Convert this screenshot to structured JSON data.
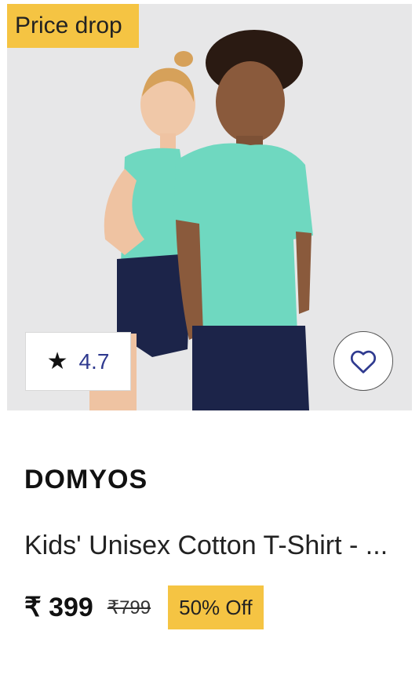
{
  "badge": {
    "label": "Price drop",
    "color": "#f5c443"
  },
  "rating": {
    "icon": "star-icon",
    "value": "4.7"
  },
  "wishlist": {
    "icon": "heart-icon"
  },
  "product": {
    "brand": "DOMYOS",
    "title": "Kids' Unisex Cotton T-Shirt - ...",
    "price": "₹ 399",
    "mrp": "₹799",
    "discount": "50% Off"
  },
  "colors": {
    "accent": "#f5c443",
    "rating_text": "#2f3a8f",
    "shirt": "#6fd8c0",
    "shorts": "#1c2449"
  }
}
